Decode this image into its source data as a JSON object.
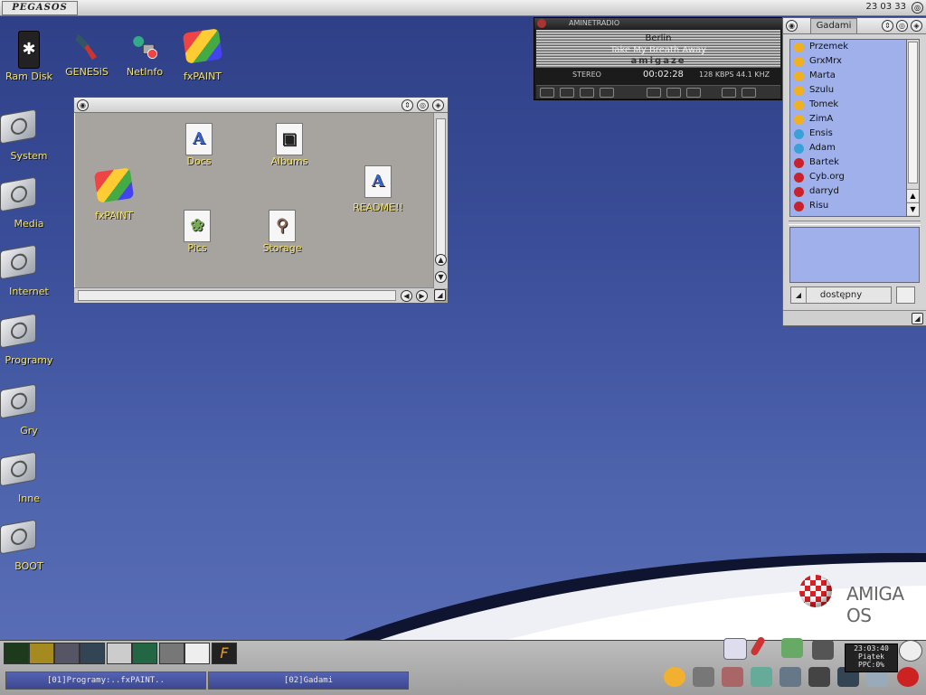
{
  "topbar": {
    "brand": "PEGASOS",
    "clock": "23 03 33"
  },
  "desktop_icons": [
    {
      "label": "Ram Disk",
      "icon": "ram-disk-icon"
    },
    {
      "label": "GENESiS",
      "icon": "genesis-icon"
    },
    {
      "label": "NetInfo",
      "icon": "netinfo-icon"
    },
    {
      "label": "fxPAINT",
      "icon": "fxpaint-icon"
    },
    {
      "label": "System",
      "icon": "drive-icon"
    },
    {
      "label": "Media",
      "icon": "drive-icon"
    },
    {
      "label": "Internet",
      "icon": "drive-icon"
    },
    {
      "label": "Programy",
      "icon": "drive-icon"
    },
    {
      "label": "Gry",
      "icon": "drive-icon"
    },
    {
      "label": "Inne",
      "icon": "drive-icon"
    },
    {
      "label": "BOOT",
      "icon": "drive-icon"
    }
  ],
  "drawer": {
    "items": [
      {
        "label": "Docs"
      },
      {
        "label": "Albums"
      },
      {
        "label": "fxPAINT"
      },
      {
        "label": "README!!"
      },
      {
        "label": "Pics"
      },
      {
        "label": "Storage"
      }
    ]
  },
  "radio": {
    "title": "AMINETRADIO",
    "line1": "Berlin",
    "line2": "Take My Breath Away",
    "line3": "amigaze",
    "mode": "STEREO",
    "time": "00:02:28",
    "bitrate": "128 KBPS 44.1 KHZ"
  },
  "chat": {
    "tab": "Gadami",
    "contacts": [
      {
        "name": "Przemek",
        "status": "online"
      },
      {
        "name": "GrxMrx",
        "status": "online"
      },
      {
        "name": "Marta",
        "status": "online"
      },
      {
        "name": "Szulu",
        "status": "online"
      },
      {
        "name": "Tomek",
        "status": "online"
      },
      {
        "name": "ZimA",
        "status": "online"
      },
      {
        "name": "Ensis",
        "status": "away"
      },
      {
        "name": "Adam",
        "status": "away"
      },
      {
        "name": "Bartek",
        "status": "offline"
      },
      {
        "name": "Cyb.org",
        "status": "offline"
      },
      {
        "name": "darryd",
        "status": "offline"
      },
      {
        "name": "Risu",
        "status": "offline"
      }
    ],
    "status_label": "dostępny",
    "status_colors": {
      "online": "#f0b020",
      "away": "#3aa0d8",
      "offline": "#c8232c"
    }
  },
  "brand_logo": {
    "text": "AMIGA OS"
  },
  "taskbar": {
    "tasks": [
      "[01]Programy:..fxPAINT..",
      "[02]Gadami"
    ],
    "sysclock": {
      "time": "23:03:40",
      "day": "Piątek",
      "ppc": "PPC:0%"
    }
  }
}
